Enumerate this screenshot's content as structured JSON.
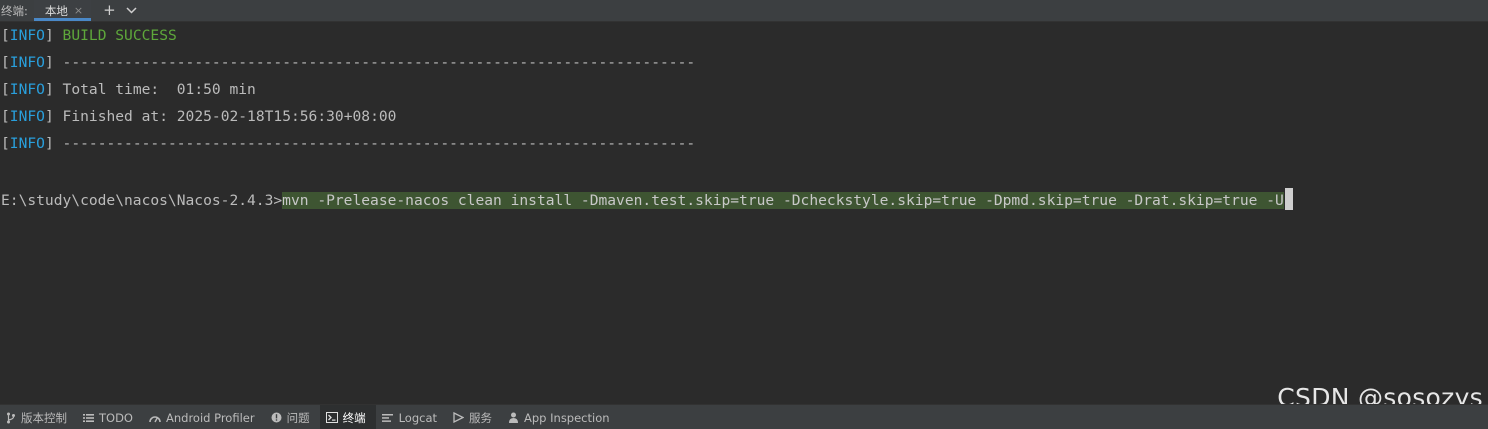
{
  "tabbar": {
    "label": "终端:",
    "tab_local": "本地",
    "close_glyph": "×",
    "add_glyph": "+"
  },
  "terminal": {
    "bracket_open": "[",
    "bracket_close": "]",
    "info_tag": "INFO",
    "lines": [
      "BUILD SUCCESS",
      "------------------------------------------------------------------------",
      "Total time:  01:50 min",
      "Finished at: 2025-02-18T15:56:30+08:00",
      "------------------------------------------------------------------------"
    ],
    "prompt": "E:\\study\\code\\nacos\\Nacos-2.4.3>",
    "command": "mvn -Prelease-nacos clean install -Dmaven.test.skip=true -Dcheckstyle.skip=true -Dpmd.skip=true -Drat.skip=true -U"
  },
  "bottombar": {
    "tools": [
      {
        "label": "版本控制",
        "icon": "branch-icon"
      },
      {
        "label": "TODO",
        "icon": "list-icon"
      },
      {
        "label": "Android Profiler",
        "icon": "gauge-icon"
      },
      {
        "label": "问题",
        "icon": "info-circle-icon"
      },
      {
        "label": "终端",
        "icon": "terminal-icon",
        "active": true
      },
      {
        "label": "Logcat",
        "icon": "logcat-icon"
      },
      {
        "label": "服务",
        "icon": "service-icon"
      },
      {
        "label": "App Inspection",
        "icon": "inspection-icon"
      }
    ]
  },
  "watermark": "CSDN @sosozys",
  "colors": {
    "background": "#2b2b2b",
    "info_tag": "#299fdc",
    "success": "#5ea83b",
    "selection": "#3e5532",
    "tab_underline": "#4a88c7"
  }
}
